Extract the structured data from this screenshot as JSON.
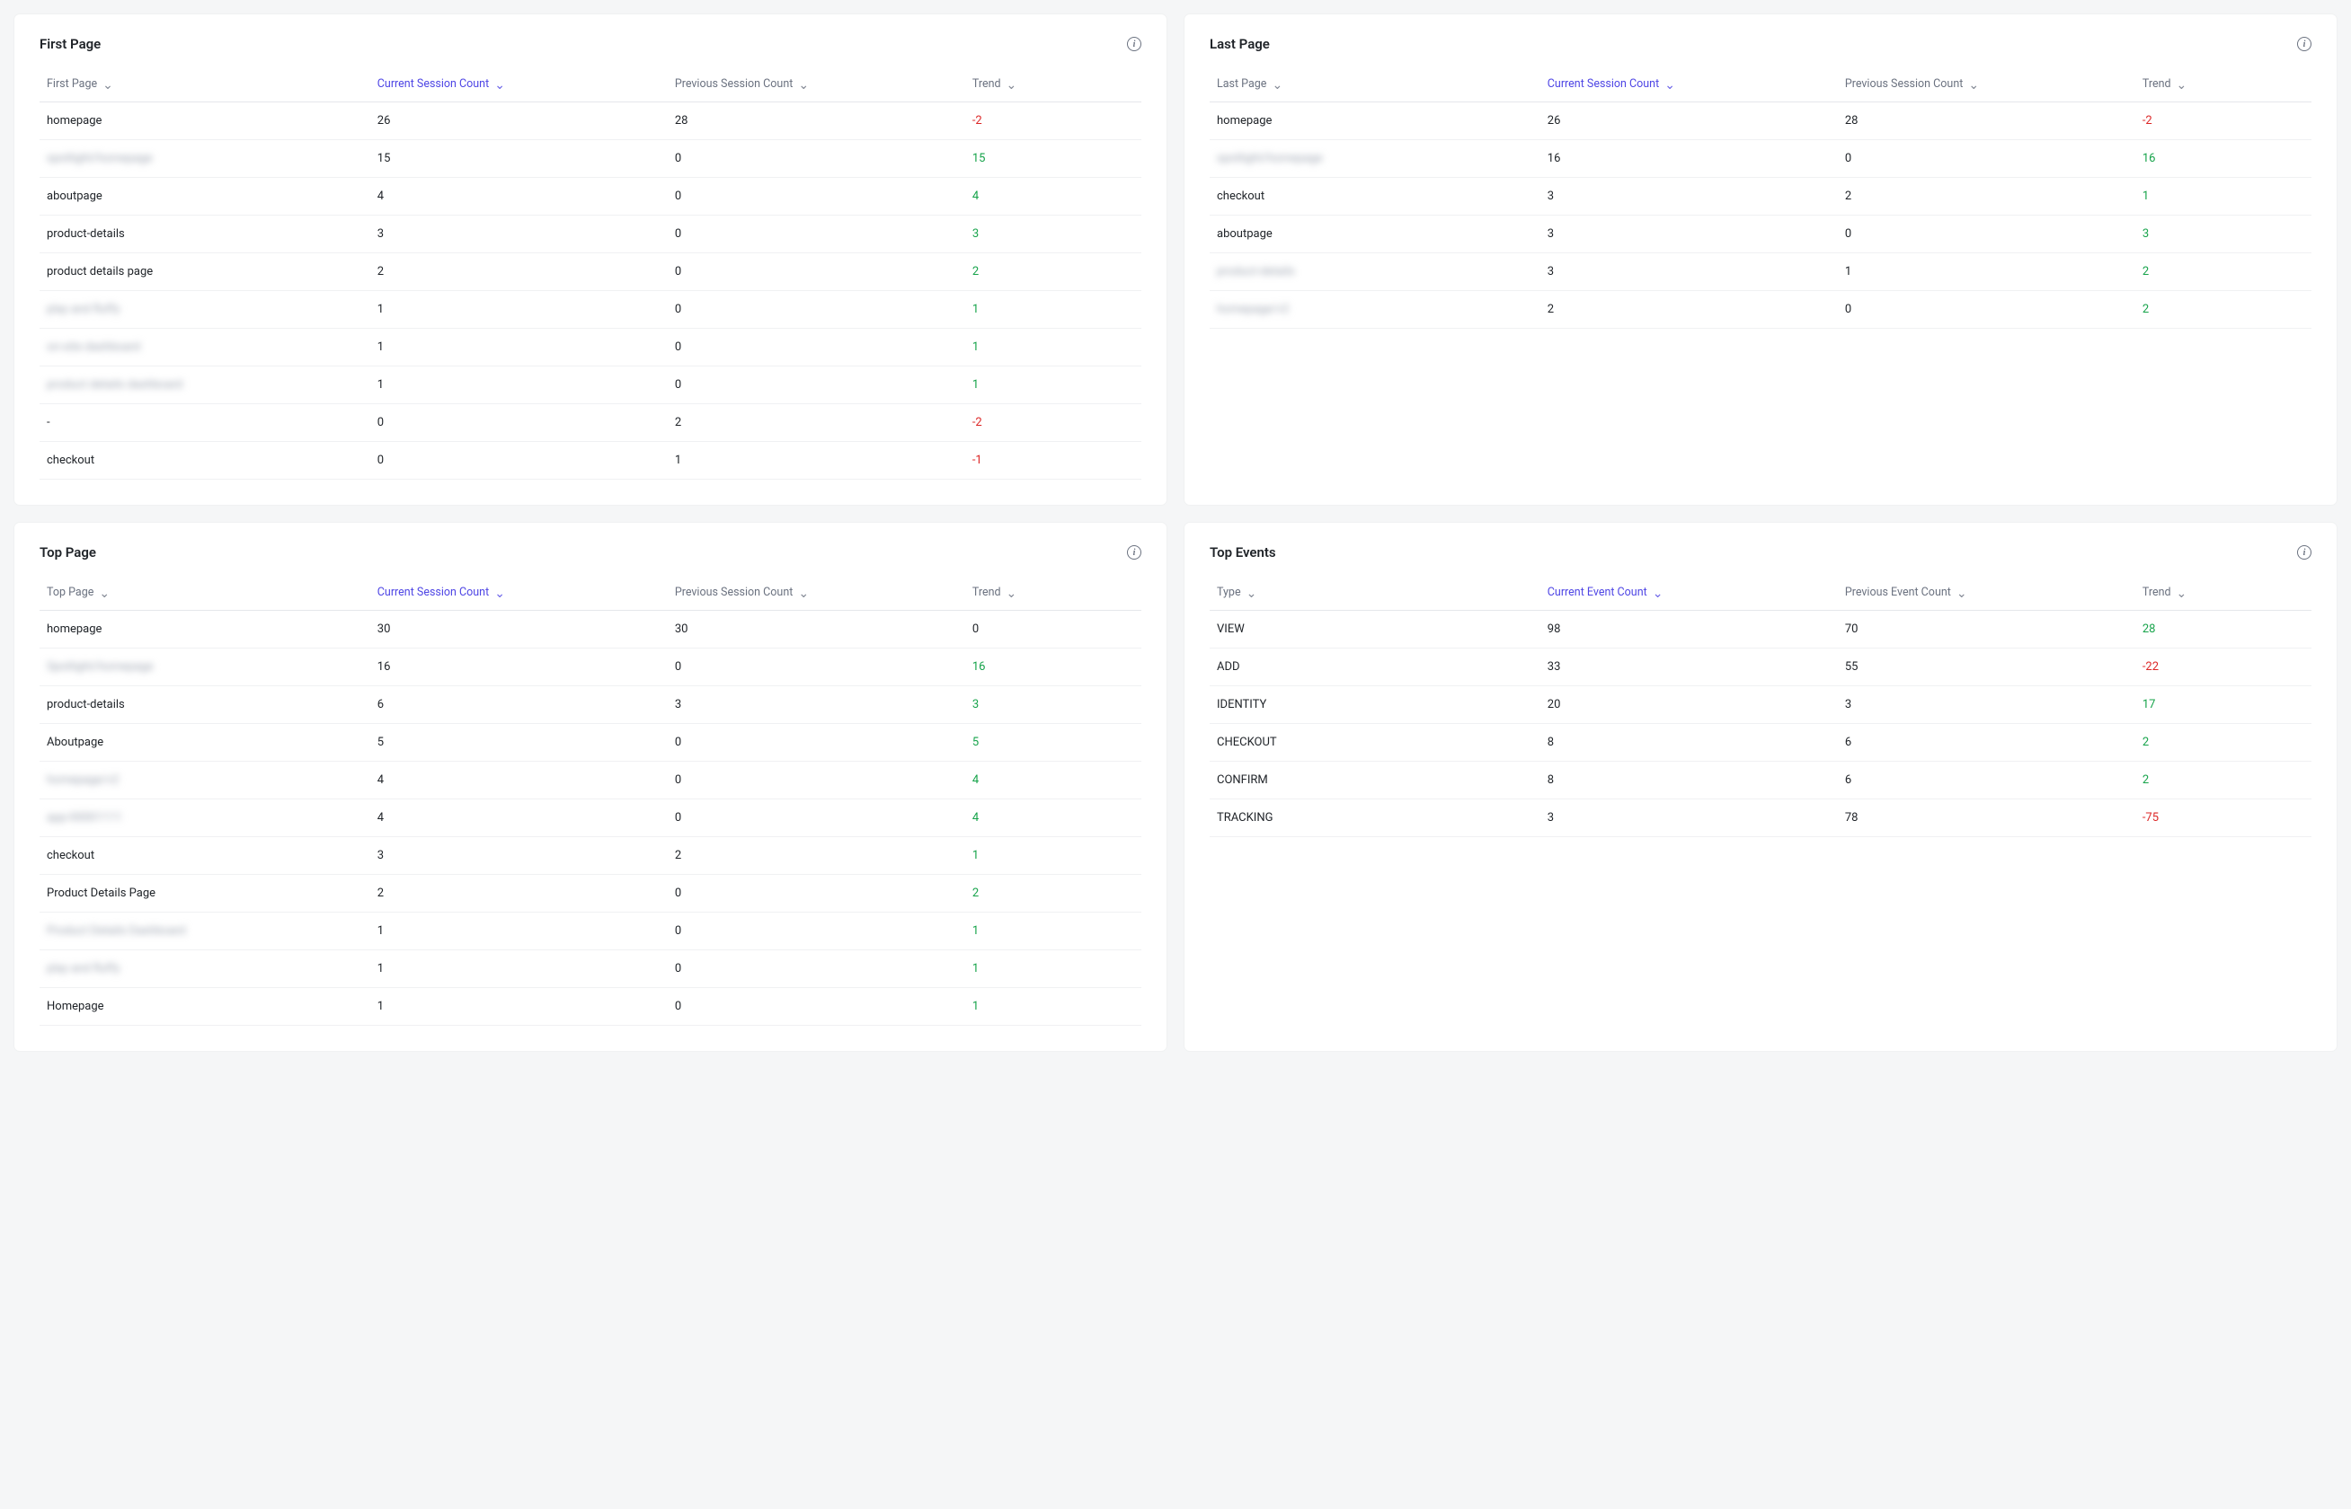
{
  "cards": [
    {
      "id": "first-page",
      "title": "First Page",
      "columns": [
        {
          "label": "First Page",
          "sorted": false
        },
        {
          "label": "Current Session Count",
          "sorted": true
        },
        {
          "label": "Previous Session Count",
          "sorted": false
        },
        {
          "label": "Trend",
          "sorted": false
        }
      ],
      "rows": [
        {
          "name": "homepage",
          "curr": 26,
          "prev": 28,
          "trend": -2,
          "blurred": false
        },
        {
          "name": "spotlight/homepage",
          "curr": 15,
          "prev": 0,
          "trend": 15,
          "blurred": true
        },
        {
          "name": "aboutpage",
          "curr": 4,
          "prev": 0,
          "trend": 4,
          "blurred": false
        },
        {
          "name": "product-details",
          "curr": 3,
          "prev": 0,
          "trend": 3,
          "blurred": false
        },
        {
          "name": "product details page",
          "curr": 2,
          "prev": 0,
          "trend": 2,
          "blurred": false
        },
        {
          "name": "play and fluffy",
          "curr": 1,
          "prev": 0,
          "trend": 1,
          "blurred": true
        },
        {
          "name": "on-site dashboard",
          "curr": 1,
          "prev": 0,
          "trend": 1,
          "blurred": true
        },
        {
          "name": "product details dashboard",
          "curr": 1,
          "prev": 0,
          "trend": 1,
          "blurred": true
        },
        {
          "name": "-",
          "curr": 0,
          "prev": 2,
          "trend": -2,
          "blurred": false
        },
        {
          "name": "checkout",
          "curr": 0,
          "prev": 1,
          "trend": -1,
          "blurred": false
        }
      ],
      "scrollable": false
    },
    {
      "id": "last-page",
      "title": "Last Page",
      "columns": [
        {
          "label": "Last Page",
          "sorted": false
        },
        {
          "label": "Current Session Count",
          "sorted": true
        },
        {
          "label": "Previous Session Count",
          "sorted": false
        },
        {
          "label": "Trend",
          "sorted": false
        }
      ],
      "rows": [
        {
          "name": "homepage",
          "curr": 26,
          "prev": 28,
          "trend": -2,
          "blurred": false
        },
        {
          "name": "spotlight/homepage",
          "curr": 16,
          "prev": 0,
          "trend": 16,
          "blurred": true
        },
        {
          "name": "checkout",
          "curr": 3,
          "prev": 2,
          "trend": 1,
          "blurred": false
        },
        {
          "name": "aboutpage",
          "curr": 3,
          "prev": 0,
          "trend": 3,
          "blurred": false
        },
        {
          "name": "product-details",
          "curr": 3,
          "prev": 1,
          "trend": 2,
          "blurred": true
        },
        {
          "name": "homepage/v2",
          "curr": 2,
          "prev": 0,
          "trend": 2,
          "blurred": true
        }
      ],
      "scrollable": false
    },
    {
      "id": "top-page",
      "title": "Top Page",
      "columns": [
        {
          "label": "Top Page",
          "sorted": false
        },
        {
          "label": "Current Session Count",
          "sorted": true
        },
        {
          "label": "Previous Session Count",
          "sorted": false
        },
        {
          "label": "Trend",
          "sorted": false
        }
      ],
      "rows": [
        {
          "name": "homepage",
          "curr": 30,
          "prev": 30,
          "trend": 0,
          "blurred": false
        },
        {
          "name": "Spotlight/homepage",
          "curr": 16,
          "prev": 0,
          "trend": 16,
          "blurred": true
        },
        {
          "name": "product-details",
          "curr": 6,
          "prev": 3,
          "trend": 3,
          "blurred": false
        },
        {
          "name": "Aboutpage",
          "curr": 5,
          "prev": 0,
          "trend": 5,
          "blurred": false
        },
        {
          "name": "homepage/v2",
          "curr": 4,
          "prev": 0,
          "trend": 4,
          "blurred": true
        },
        {
          "name": "app-00001111",
          "curr": 4,
          "prev": 0,
          "trend": 4,
          "blurred": true
        },
        {
          "name": "checkout",
          "curr": 3,
          "prev": 2,
          "trend": 1,
          "blurred": false
        },
        {
          "name": "Product Details Page",
          "curr": 2,
          "prev": 0,
          "trend": 2,
          "blurred": false
        },
        {
          "name": "Product Details Dashboard",
          "curr": 1,
          "prev": 0,
          "trend": 1,
          "blurred": true
        },
        {
          "name": "play and fluffy",
          "curr": 1,
          "prev": 0,
          "trend": 1,
          "blurred": true
        },
        {
          "name": "Homepage",
          "curr": 1,
          "prev": 0,
          "trend": 1,
          "blurred": false
        }
      ],
      "scrollable": true
    },
    {
      "id": "top-events",
      "title": "Top Events",
      "columns": [
        {
          "label": "Type",
          "sorted": false
        },
        {
          "label": "Current Event Count",
          "sorted": true
        },
        {
          "label": "Previous Event Count",
          "sorted": false
        },
        {
          "label": "Trend",
          "sorted": false
        }
      ],
      "rows": [
        {
          "name": "VIEW",
          "curr": 98,
          "prev": 70,
          "trend": 28,
          "blurred": false
        },
        {
          "name": "ADD",
          "curr": 33,
          "prev": 55,
          "trend": -22,
          "blurred": false
        },
        {
          "name": "IDENTITY",
          "curr": 20,
          "prev": 3,
          "trend": 17,
          "blurred": false
        },
        {
          "name": "CHECKOUT",
          "curr": 8,
          "prev": 6,
          "trend": 2,
          "blurred": false
        },
        {
          "name": "CONFIRM",
          "curr": 8,
          "prev": 6,
          "trend": 2,
          "blurred": false
        },
        {
          "name": "TRACKING",
          "curr": 3,
          "prev": 78,
          "trend": -75,
          "blurred": false
        }
      ],
      "scrollable": false
    }
  ]
}
